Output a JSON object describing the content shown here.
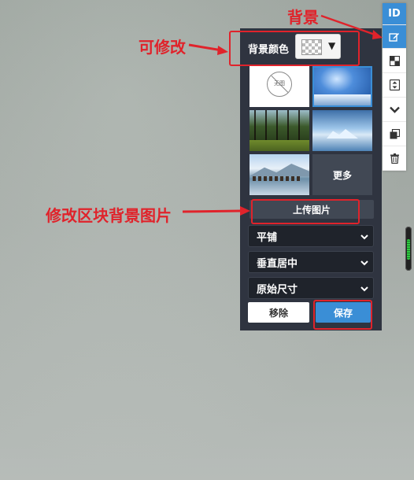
{
  "toolbar": {
    "id_label": "ID",
    "buttons": [
      "id-button",
      "edit-background-button",
      "layout-button",
      "align-button",
      "collapse-button",
      "copy-button",
      "delete-button"
    ]
  },
  "panel": {
    "color_label": "背景颜色",
    "no_image_label": "无图",
    "more_label": "更多",
    "upload_label": "上传图片",
    "repeat_value": "平铺",
    "position_value": "垂直居中",
    "size_value": "原始尺寸",
    "remove_label": "移除",
    "save_label": "保存"
  },
  "annotations": {
    "background": "背景",
    "editable": "可修改",
    "modify_block_bg": "修改区块背景图片"
  },
  "colors": {
    "accent": "#3a8ed6",
    "panel_bg": "#2f3440",
    "annotation_red": "#e0232b"
  }
}
